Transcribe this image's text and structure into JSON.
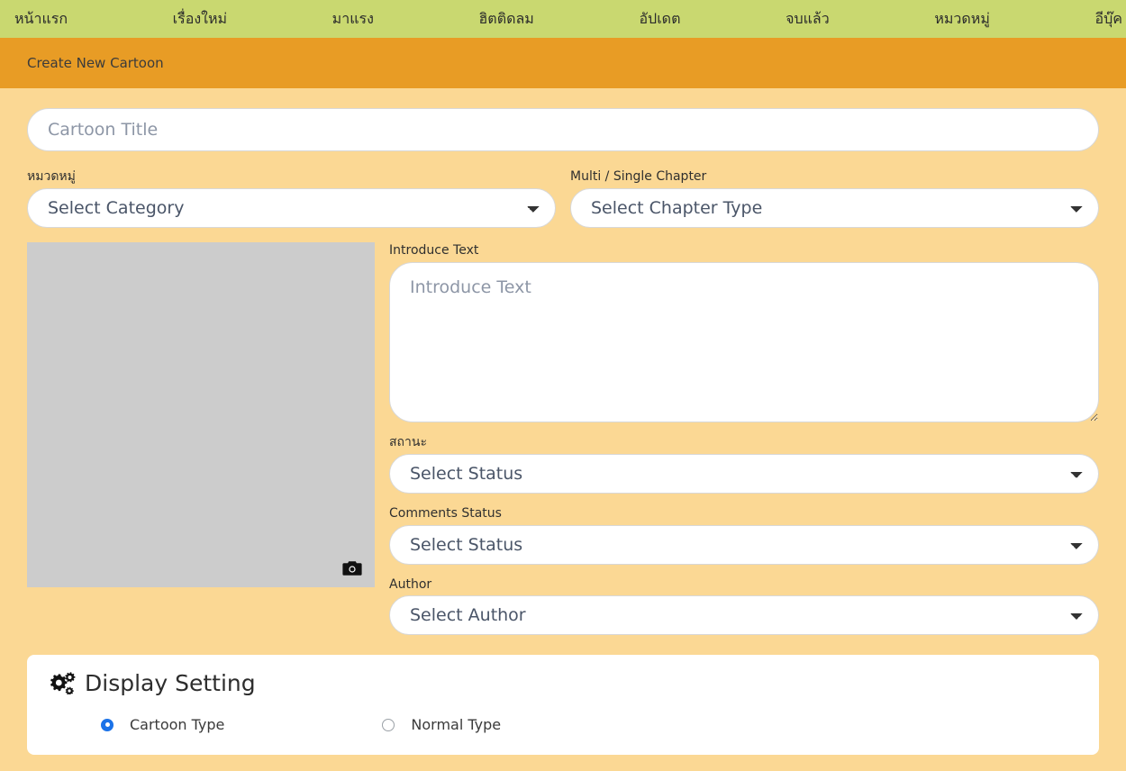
{
  "nav": {
    "items": [
      {
        "label": "หน้าแรก",
        "name": "nav-home"
      },
      {
        "label": "เรื่องใหม่",
        "name": "nav-new"
      },
      {
        "label": "มาแรง",
        "name": "nav-trending"
      },
      {
        "label": "ฮิตติดลม",
        "name": "nav-popular"
      },
      {
        "label": "อัปเดต",
        "name": "nav-update"
      },
      {
        "label": "จบแล้ว",
        "name": "nav-completed"
      },
      {
        "label": "หมวดหมู่",
        "name": "nav-category"
      },
      {
        "label": "อีบุ๊ค",
        "name": "nav-ebook"
      }
    ]
  },
  "header": {
    "title": "Create New Cartoon"
  },
  "form": {
    "title_placeholder": "Cartoon Title",
    "title_value": "",
    "category_label": "หมวดหมู่",
    "category_value": "Select Category",
    "chapter_label": "Multi / Single Chapter",
    "chapter_value": "Select Chapter Type",
    "introduce_label": "Introduce Text",
    "introduce_placeholder": "Introduce Text",
    "introduce_value": "",
    "status_label": "สถานะ",
    "status_value": "Select Status",
    "comments_status_label": "Comments Status",
    "comments_status_value": "Select Status",
    "author_label": "Author",
    "author_value": "Select Author",
    "cover_icon": "camera-icon"
  },
  "display_setting": {
    "icon": "cogs-icon",
    "title": "Display Setting",
    "options": [
      {
        "label": "Cartoon Type",
        "selected": true
      },
      {
        "label": "Normal Type",
        "selected": false
      }
    ]
  },
  "colors": {
    "nav_bg": "#c9d870",
    "header_bg": "#e89c25",
    "page_bg": "#fbd894",
    "placeholder_bg": "#cccccc",
    "radio_accent": "#1b72e8"
  }
}
